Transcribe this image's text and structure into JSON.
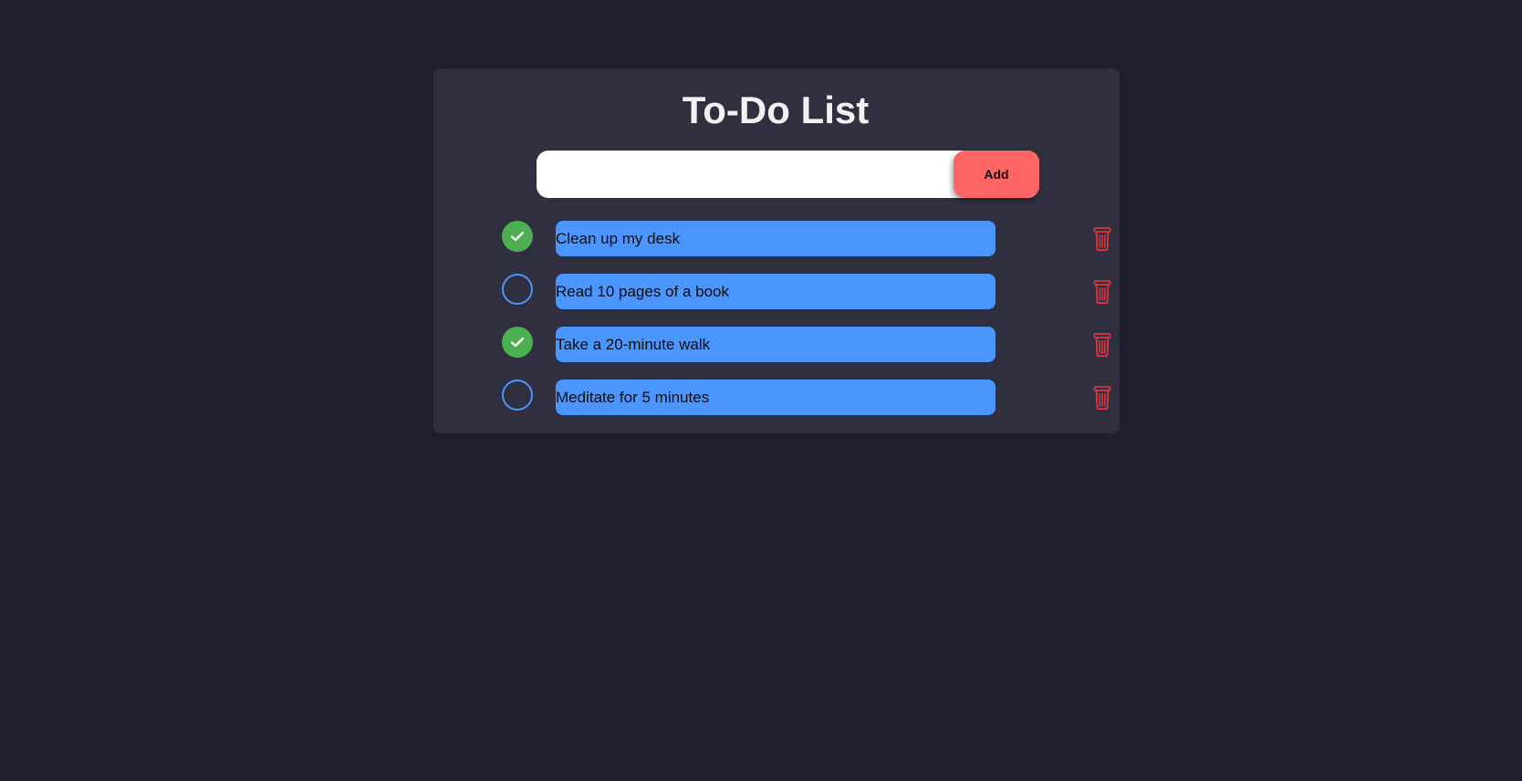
{
  "app": {
    "title": "To-Do List"
  },
  "input": {
    "value": "",
    "placeholder": ""
  },
  "add_button": {
    "label": "Add"
  },
  "tasks": [
    {
      "text": "Clean up my desk",
      "completed": true
    },
    {
      "text": "Read 10 pages of a book",
      "completed": false
    },
    {
      "text": "Take a 20-minute walk",
      "completed": true
    },
    {
      "text": "Meditate for 5 minutes",
      "completed": false
    }
  ],
  "icons": {
    "complete": "checkmark-icon",
    "delete": "trash-icon"
  },
  "colors": {
    "background": "#201f2e",
    "card": "#302f40",
    "accent_blue": "#4b95ff",
    "done_green": "#4caf50",
    "add_red": "#ff6464",
    "trash_red": "#e0353f"
  }
}
